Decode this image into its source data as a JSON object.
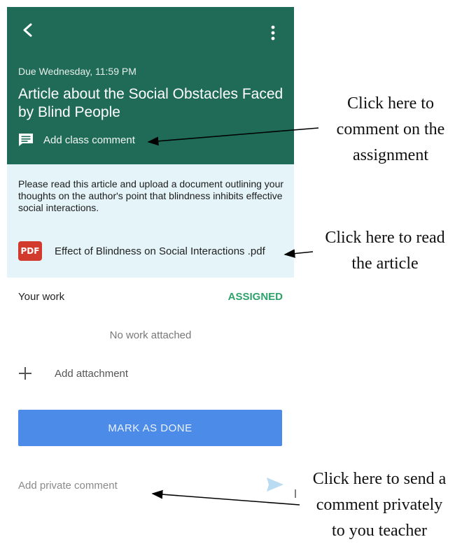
{
  "header": {
    "due": "Due Wednesday, 11:59 PM",
    "title": "Article about the Social Obstacles Faced by Blind People",
    "class_comment_label": "Add class comment"
  },
  "assignment": {
    "description": "Please read this article and upload a document outlining your thoughts on the author's point that blindness inhibits effective social interactions.",
    "pdf_badge": "PDF",
    "pdf_name": "Effect of Blindness on Social Interactions .pdf"
  },
  "work": {
    "label": "Your work",
    "status": "ASSIGNED",
    "empty_text": "No work attached",
    "add_attachment": "Add attachment",
    "mark_done": "MARK AS DONE",
    "private_comment_placeholder": "Add private comment"
  },
  "annotations": {
    "comment": [
      "Click here to",
      "comment on the",
      "assignment"
    ],
    "read": [
      "Click here to read",
      "the article"
    ],
    "private": [
      "Click here to send a",
      "comment privately",
      "to you teacher"
    ]
  },
  "colors": {
    "header_bg": "#1f6b58",
    "desc_bg": "#e4f4f9",
    "pdf_red": "#d23a2d",
    "assigned_green": "#2da26b",
    "button_blue": "#4d8be8"
  },
  "icons": [
    "back-arrow-icon",
    "more-vert-icon",
    "comment-icon",
    "pdf-icon",
    "plus-icon",
    "send-icon"
  ]
}
